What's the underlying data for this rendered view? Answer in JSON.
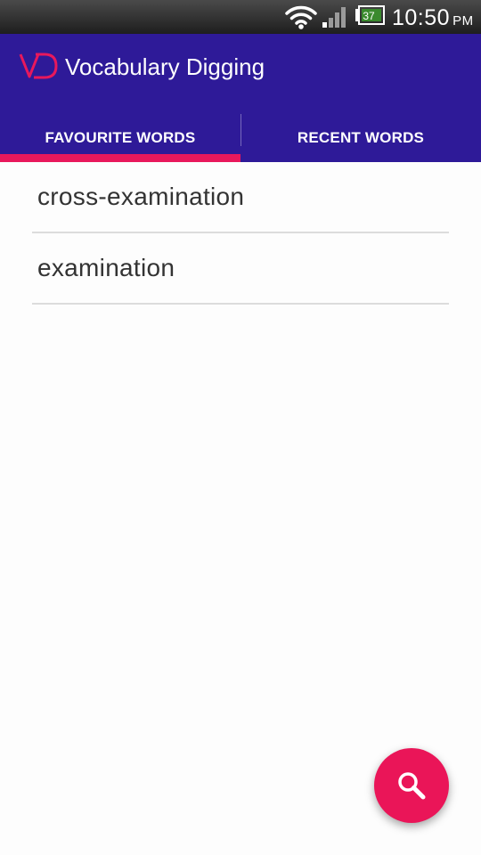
{
  "status_bar": {
    "battery_level": "37",
    "time": "10:50",
    "ampm": "PM",
    "icons": [
      "wifi-icon",
      "signal-icon",
      "battery-icon"
    ]
  },
  "app": {
    "title": "Vocabulary Digging",
    "logo_text": "VD",
    "colors": {
      "primary": "#2e1a98",
      "accent": "#e8185c"
    }
  },
  "tabs": [
    {
      "label": "FAVOURITE WORDS",
      "selected": true
    },
    {
      "label": "RECENT WORDS",
      "selected": false
    }
  ],
  "words": [
    {
      "text": "cross-examination"
    },
    {
      "text": "examination"
    }
  ],
  "fab": {
    "icon": "search-icon"
  }
}
